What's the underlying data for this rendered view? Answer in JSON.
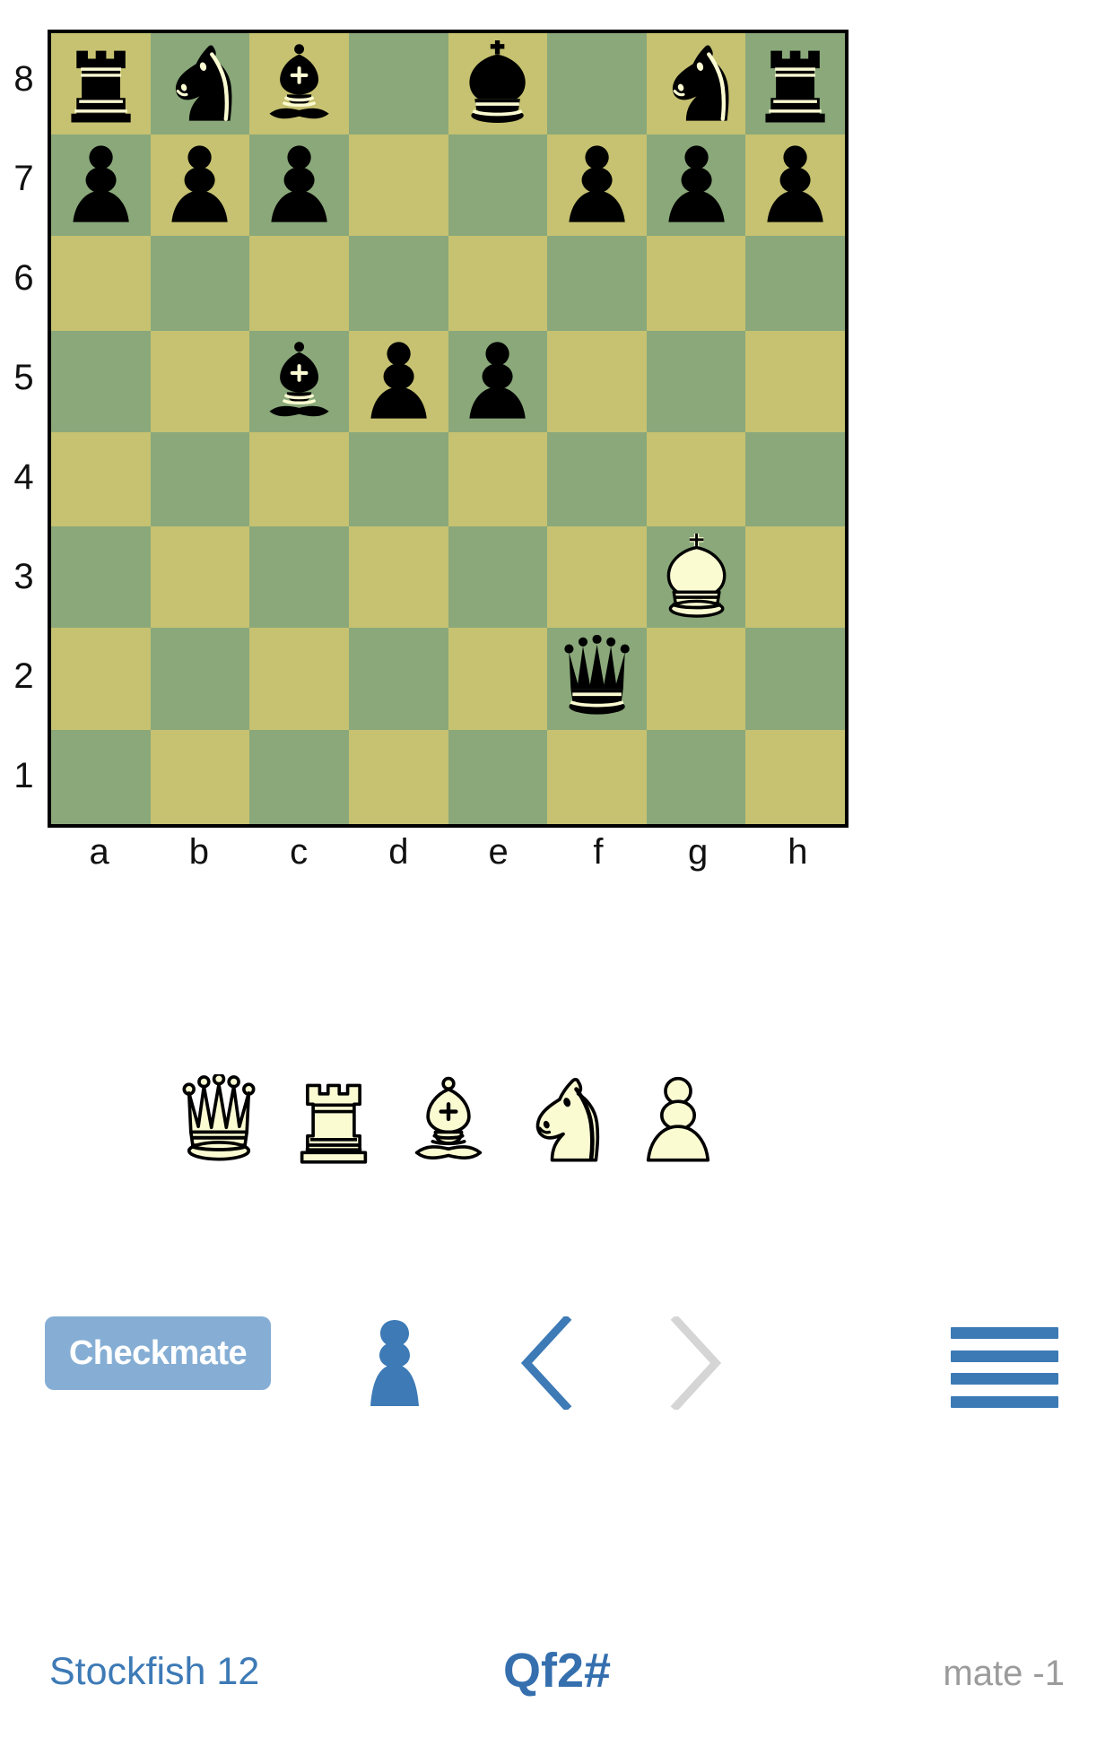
{
  "board": {
    "light_square_color": "#c6c271",
    "dark_square_color": "#8aa87a",
    "border_color": "#000000",
    "orientation": "white-bottom",
    "rank_labels": [
      "8",
      "7",
      "6",
      "5",
      "4",
      "3",
      "2",
      "1"
    ],
    "file_labels": [
      "a",
      "b",
      "c",
      "d",
      "e",
      "f",
      "g",
      "h"
    ],
    "fen_position": "rnb1k1nr/ppp2ppp/8/2bpp3/8/6K1/5q2/8",
    "squares": [
      [
        {
          "piece": "rook",
          "color": "black",
          "square": "a8"
        },
        {
          "piece": "knight",
          "color": "black",
          "square": "b8"
        },
        {
          "piece": "bishop",
          "color": "black",
          "square": "c8"
        },
        {
          "piece": null,
          "square": "d8"
        },
        {
          "piece": "king",
          "color": "black",
          "square": "e8"
        },
        {
          "piece": null,
          "square": "f8"
        },
        {
          "piece": "knight",
          "color": "black",
          "square": "g8"
        },
        {
          "piece": "rook",
          "color": "black",
          "square": "h8"
        }
      ],
      [
        {
          "piece": "pawn",
          "color": "black",
          "square": "a7"
        },
        {
          "piece": "pawn",
          "color": "black",
          "square": "b7"
        },
        {
          "piece": "pawn",
          "color": "black",
          "square": "c7"
        },
        {
          "piece": null,
          "square": "d7"
        },
        {
          "piece": null,
          "square": "e7"
        },
        {
          "piece": "pawn",
          "color": "black",
          "square": "f7"
        },
        {
          "piece": "pawn",
          "color": "black",
          "square": "g7"
        },
        {
          "piece": "pawn",
          "color": "black",
          "square": "h7"
        }
      ],
      [
        {
          "piece": null,
          "square": "a6"
        },
        {
          "piece": null,
          "square": "b6"
        },
        {
          "piece": null,
          "square": "c6"
        },
        {
          "piece": null,
          "square": "d6"
        },
        {
          "piece": null,
          "square": "e6"
        },
        {
          "piece": null,
          "square": "f6"
        },
        {
          "piece": null,
          "square": "g6"
        },
        {
          "piece": null,
          "square": "h6"
        }
      ],
      [
        {
          "piece": null,
          "square": "a5"
        },
        {
          "piece": null,
          "square": "b5"
        },
        {
          "piece": "bishop",
          "color": "black",
          "square": "c5"
        },
        {
          "piece": "pawn",
          "color": "black",
          "square": "d5"
        },
        {
          "piece": "pawn",
          "color": "black",
          "square": "e5"
        },
        {
          "piece": null,
          "square": "f5"
        },
        {
          "piece": null,
          "square": "g5"
        },
        {
          "piece": null,
          "square": "h5"
        }
      ],
      [
        {
          "piece": null,
          "square": "a4"
        },
        {
          "piece": null,
          "square": "b4"
        },
        {
          "piece": null,
          "square": "c4"
        },
        {
          "piece": null,
          "square": "d4"
        },
        {
          "piece": null,
          "square": "e4"
        },
        {
          "piece": null,
          "square": "f4"
        },
        {
          "piece": null,
          "square": "g4"
        },
        {
          "piece": null,
          "square": "h4"
        }
      ],
      [
        {
          "piece": null,
          "square": "a3"
        },
        {
          "piece": null,
          "square": "b3"
        },
        {
          "piece": null,
          "square": "c3"
        },
        {
          "piece": null,
          "square": "d3"
        },
        {
          "piece": null,
          "square": "e3"
        },
        {
          "piece": null,
          "square": "f3"
        },
        {
          "piece": "king",
          "color": "white",
          "square": "g3"
        },
        {
          "piece": null,
          "square": "h3"
        }
      ],
      [
        {
          "piece": null,
          "square": "a2"
        },
        {
          "piece": null,
          "square": "b2"
        },
        {
          "piece": null,
          "square": "c2"
        },
        {
          "piece": null,
          "square": "d2"
        },
        {
          "piece": null,
          "square": "e2"
        },
        {
          "piece": "queen",
          "color": "black",
          "square": "f2"
        },
        {
          "piece": null,
          "square": "g2"
        },
        {
          "piece": null,
          "square": "h2"
        }
      ],
      [
        {
          "piece": null,
          "square": "a1"
        },
        {
          "piece": null,
          "square": "b1"
        },
        {
          "piece": null,
          "square": "c1"
        },
        {
          "piece": null,
          "square": "d1"
        },
        {
          "piece": null,
          "square": "e1"
        },
        {
          "piece": null,
          "square": "f1"
        },
        {
          "piece": null,
          "square": "g1"
        },
        {
          "piece": null,
          "square": "h1"
        }
      ]
    ]
  },
  "captured": {
    "color": "white",
    "pieces": [
      {
        "piece": "queen",
        "icon": "white-queen-icon"
      },
      {
        "piece": "rook",
        "icon": "white-rook-icon"
      },
      {
        "piece": "bishop",
        "icon": "white-bishop-icon"
      },
      {
        "piece": "knight",
        "icon": "white-knight-icon"
      },
      {
        "piece": "pawn",
        "icon": "white-pawn-icon"
      }
    ]
  },
  "controls": {
    "status_label": "Checkmate",
    "status_button_color": "#86aed4",
    "turn_indicator": {
      "icon": "pawn-icon",
      "color": "#3d7ab6",
      "side": "black-to-move"
    },
    "prev_button": {
      "icon": "chevron-left-icon",
      "color": "#3d7ab6",
      "enabled": true
    },
    "next_button": {
      "icon": "chevron-right-icon",
      "color": "#d5d5d5",
      "enabled": false
    },
    "menu_button": {
      "icon": "hamburger-menu-icon",
      "color": "#3c7ab5"
    }
  },
  "footer": {
    "engine_name": "Stockfish 12",
    "move_san": "Qf2#",
    "eval_score": "mate -1",
    "engine_color": "#3d7ab6",
    "move_color": "#356fae",
    "eval_color": "#9b9b9b"
  }
}
